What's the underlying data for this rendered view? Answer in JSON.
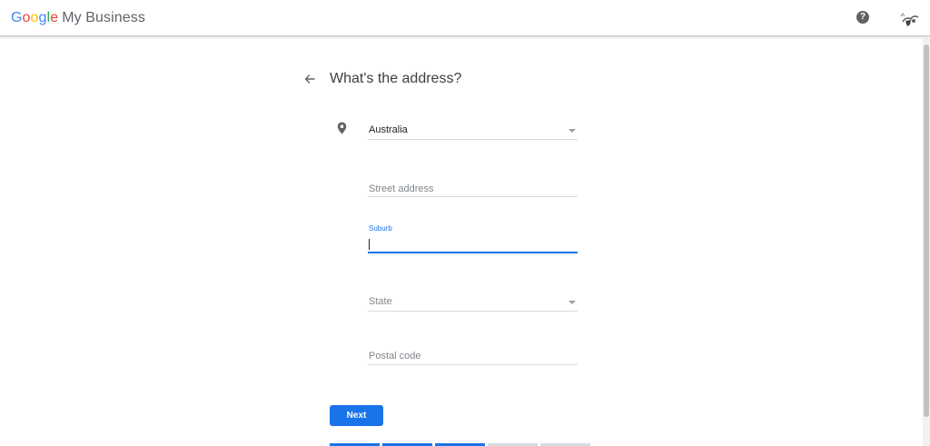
{
  "header": {
    "logo_google": "Google",
    "logo_brand": "My Business",
    "help_icon_glyph": "?",
    "colors": {
      "g_blue": "#4285F4",
      "g_red": "#EA4335",
      "g_yellow": "#FBBC05",
      "g_green": "#34A853"
    }
  },
  "page": {
    "title": "What's the address?"
  },
  "form": {
    "country": {
      "value": "Australia"
    },
    "street": {
      "placeholder": "Street address"
    },
    "suburb": {
      "floating_label": "Suburb",
      "value": ""
    },
    "state": {
      "placeholder": "State"
    },
    "postal": {
      "placeholder": "Postal code"
    }
  },
  "actions": {
    "next_label": "Next"
  },
  "progress": {
    "total_steps": 5,
    "completed_steps": 3,
    "active_color": "#1a73e8",
    "inactive_color": "#dadce0"
  },
  "icons": {
    "back": "arrow-back-icon",
    "pin": "location-pin-icon",
    "help": "help-icon",
    "avatar": "avatar-icon",
    "dropdown": "chevron-down-icon"
  }
}
